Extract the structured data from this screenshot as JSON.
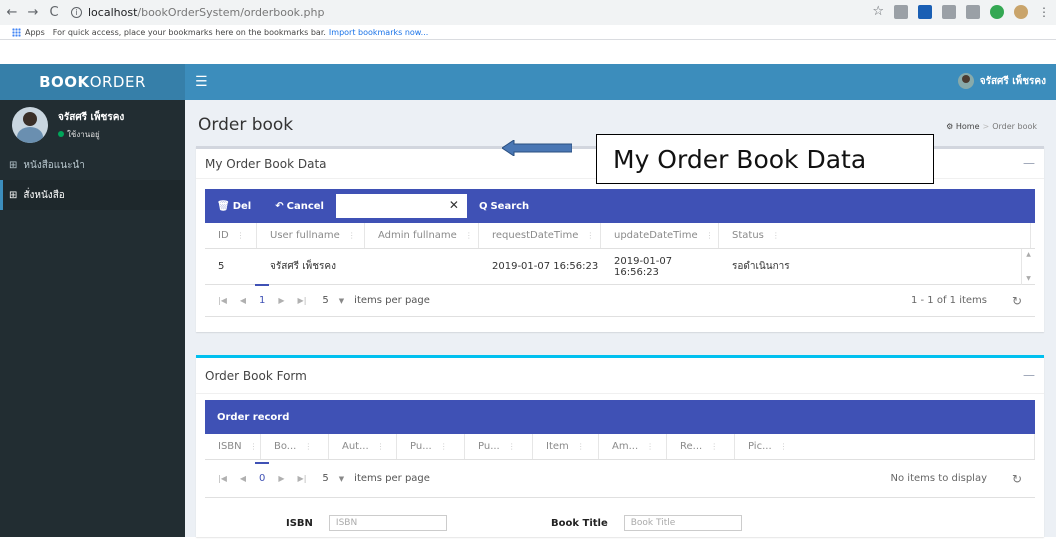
{
  "browser": {
    "url_host": "localhost",
    "url_path": "/bookOrderSystem/orderbook.php",
    "bookmarks_apps": "Apps",
    "bookmarks_hint": "For quick access, place your bookmarks here on the bookmarks bar.",
    "bookmarks_link": "Import bookmarks now..."
  },
  "header": {
    "logo_bold": "BOOK",
    "logo_rest": "ORDER",
    "user_name": "จรัสศรี เพ็ชรคง"
  },
  "sidebar": {
    "user_name": "จรัสศรี เพ็ชรคง",
    "user_status": "ใช้งานอยู่",
    "items": [
      {
        "label": "หนังสือแนะนำ"
      },
      {
        "label": "สั่งหนังสือ"
      }
    ]
  },
  "page": {
    "title": "Order book",
    "breadcrumb": [
      "Home",
      "Order book"
    ]
  },
  "order_data_box": {
    "title": "My Order Book Data",
    "toolbar": {
      "del": "Del",
      "cancel": "Cancel",
      "search": "Search"
    },
    "columns": [
      "ID",
      "User fullname",
      "Admin fullname",
      "requestDateTime",
      "updateDateTime",
      "Status"
    ],
    "rows": [
      {
        "id": "5",
        "user": "จรัสศรี เพ็ชรคง",
        "admin": "",
        "request": "2019-01-07 16:56:23",
        "update": "2019-01-07 16:56:23",
        "status": "รอดำเนินการ"
      }
    ],
    "pager": {
      "page": "1",
      "size": "5",
      "label": "items per page",
      "info": "1 - 1 of 1 items"
    }
  },
  "order_form_box": {
    "title": "Order Book Form",
    "toolbar_label": "Order record",
    "columns": [
      "ISBN",
      "Bo...",
      "Aut...",
      "Pu...",
      "Pu...",
      "Item",
      "Am...",
      "Re...",
      "Pic..."
    ],
    "pager": {
      "page": "0",
      "size": "5",
      "label": "items per page",
      "info": "No items to display"
    },
    "fields": [
      {
        "label": "ISBN",
        "placeholder": "ISBN"
      },
      {
        "label": "Book Title",
        "placeholder": "Book Title"
      }
    ]
  },
  "annotation": {
    "text": "My Order Book Data"
  }
}
